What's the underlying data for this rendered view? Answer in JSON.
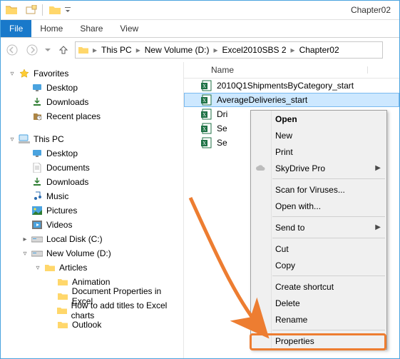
{
  "window": {
    "title": "Chapter02"
  },
  "ribbon": {
    "file": "File",
    "tabs": [
      "Home",
      "Share",
      "View"
    ]
  },
  "breadcrumb": [
    "This PC",
    "New Volume (D:)",
    "Excel2010SBS 2",
    "Chapter02"
  ],
  "nav": {
    "favorites": {
      "label": "Favorites",
      "items": [
        "Desktop",
        "Downloads",
        "Recent places"
      ]
    },
    "thispc": {
      "label": "This PC",
      "items": [
        "Desktop",
        "Documents",
        "Downloads",
        "Music",
        "Pictures",
        "Videos",
        "Local Disk (C:)"
      ],
      "newvol": {
        "label": "New Volume (D:)",
        "articles": {
          "label": "Articles",
          "items": [
            "Animation",
            "Document Properties in Excel",
            "How to add titles to Excel charts",
            "Outlook"
          ]
        }
      }
    }
  },
  "columns": {
    "name": "Name"
  },
  "files": [
    "2010Q1ShipmentsByCategory_start",
    "AverageDeliveries_start",
    "Dri",
    "Se",
    "Se"
  ],
  "selected_index": 1,
  "context_menu": {
    "open": "Open",
    "new": "New",
    "print": "Print",
    "skydrive": "SkyDrive Pro",
    "scan": "Scan for Viruses...",
    "openwith": "Open with...",
    "sendto": "Send to",
    "cut": "Cut",
    "copy": "Copy",
    "shortcut": "Create shortcut",
    "delete": "Delete",
    "rename": "Rename",
    "properties": "Properties"
  }
}
